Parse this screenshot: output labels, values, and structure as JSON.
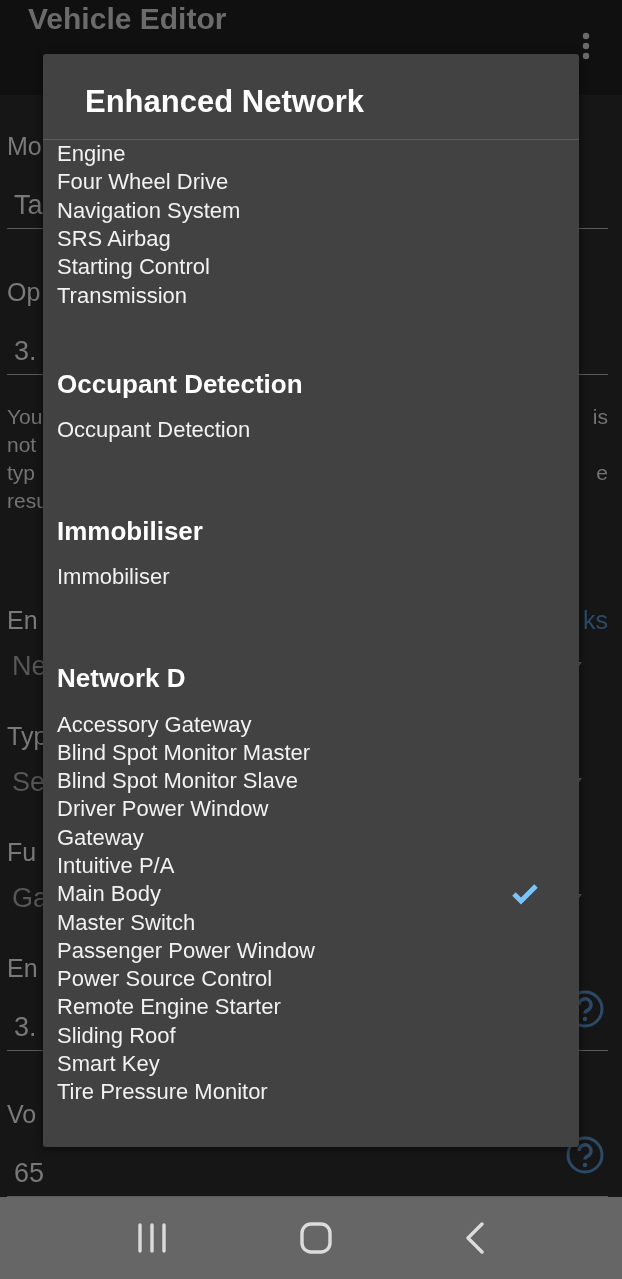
{
  "app_bar": {
    "title": "Vehicle Editor"
  },
  "form": [
    {
      "kind": "label",
      "text": "Mo"
    },
    {
      "kind": "value",
      "text": "Ta"
    },
    {
      "kind": "label",
      "text": "Op"
    },
    {
      "kind": "value",
      "text": "3."
    },
    {
      "kind": "para",
      "text": "You",
      "right": "is"
    },
    {
      "kind": "para",
      "text": "not"
    },
    {
      "kind": "para",
      "text": "typ",
      "right": "e"
    },
    {
      "kind": "para",
      "text": "resu"
    },
    {
      "kind": "label",
      "text": "En",
      "link": "ks"
    },
    {
      "kind": "select",
      "text": "Ne"
    },
    {
      "kind": "label",
      "text": "Typ"
    },
    {
      "kind": "select",
      "text": "Se"
    },
    {
      "kind": "label",
      "text": "Fu"
    },
    {
      "kind": "select",
      "text": "Ga"
    },
    {
      "kind": "label",
      "text": "En"
    },
    {
      "kind": "value",
      "text": "3.",
      "help": true
    },
    {
      "kind": "label",
      "text": "Vo"
    },
    {
      "kind": "value",
      "text": "65",
      "help": true
    }
  ],
  "dialog": {
    "title": "Enhanced Network",
    "groups": [
      {
        "items": [
          {
            "label": "Engine",
            "checked": false
          },
          {
            "label": "Four Wheel Drive",
            "checked": false
          },
          {
            "label": "Navigation System",
            "checked": false
          },
          {
            "label": "SRS Airbag",
            "checked": false
          },
          {
            "label": "Starting Control",
            "checked": false
          },
          {
            "label": "Transmission",
            "checked": false
          }
        ]
      },
      {
        "heading": "Occupant Detection",
        "items": [
          {
            "label": "Occupant Detection",
            "checked": false
          }
        ]
      },
      {
        "heading": "Immobiliser",
        "items": [
          {
            "label": "Immobiliser",
            "checked": false
          }
        ]
      },
      {
        "heading": "Network D",
        "items": [
          {
            "label": "Accessory Gateway",
            "checked": false
          },
          {
            "label": "Blind Spot Monitor Master",
            "checked": false
          },
          {
            "label": "Blind Spot Monitor Slave",
            "checked": false
          },
          {
            "label": "Driver Power Window",
            "checked": false
          },
          {
            "label": "Gateway",
            "checked": false
          },
          {
            "label": "Intuitive P/A",
            "checked": false
          },
          {
            "label": "Main Body",
            "checked": true
          },
          {
            "label": "Master Switch",
            "checked": false
          },
          {
            "label": "Passenger Power Window",
            "checked": false
          },
          {
            "label": "Power Source Control",
            "checked": false
          },
          {
            "label": "Remote Engine Starter",
            "checked": false
          },
          {
            "label": "Sliding Roof",
            "checked": false
          },
          {
            "label": "Smart Key",
            "checked": false
          },
          {
            "label": "Tire Pressure Monitor",
            "checked": false
          }
        ]
      }
    ]
  }
}
